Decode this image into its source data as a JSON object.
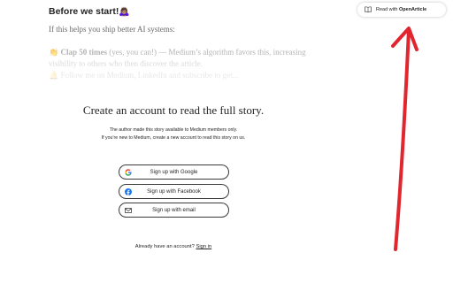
{
  "article": {
    "heading": "Before we start!",
    "heading_emoji": "🙇🏽‍♀️",
    "line1": "If this helps you ship better AI systems:",
    "clap_emoji": "👏",
    "clap_bold": "Clap 50 times",
    "clap_rest": " (yes, you can!) — Medium’s algorithm favors this, increasing",
    "clap_line2": "visibility to others who then discover the article.",
    "follow_line": "🔔 Follow me on Medium, LinkedIn and subscribe to get..."
  },
  "paywall": {
    "title": "Create an account to read the full story.",
    "subtitle_1": "The author made this story available to Medium members only.",
    "subtitle_2": "If you’re new to Medium, create a new account to read this story on us.",
    "buttons": {
      "google": "Sign up with Google",
      "facebook": "Sign up with Facebook",
      "email": "Sign up with email"
    },
    "signin_prompt": "Already have an account?",
    "signin_link": "Sign in"
  },
  "extension": {
    "prefix": "Read with ",
    "name": "OpenArticle"
  },
  "colors": {
    "annotation_arrow": "#e0262f",
    "facebook": "#1877f2",
    "button_border": "#3a3a3a"
  },
  "icons": [
    "google-icon",
    "facebook-icon",
    "mail-icon",
    "book-icon",
    "arrow-annotation"
  ]
}
